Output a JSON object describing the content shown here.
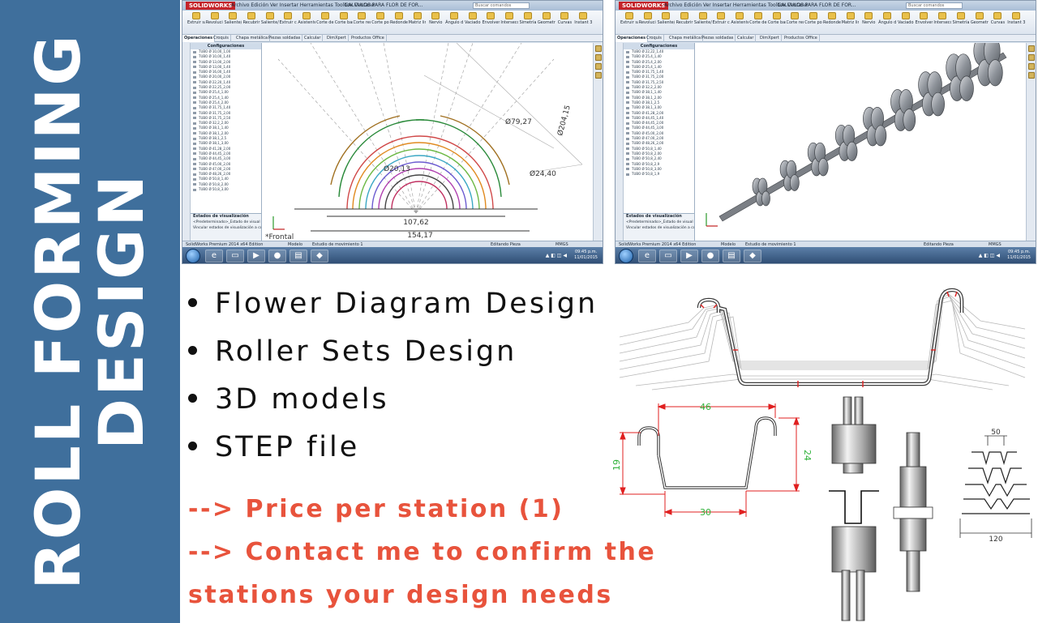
{
  "banner": {
    "line1": "ROLL FORMING",
    "line2": "DESIGN",
    "background_color": "#3f6f9c",
    "text_color": "#ffffff"
  },
  "features": [
    "Flower Diagram Design",
    "Roller Sets Design",
    "3D models",
    "STEP file"
  ],
  "cta": {
    "line1": "--> Price per station (1)",
    "line2": "--> Contact me to confirm the",
    "line3": "stations your design needs",
    "color": "#e8533c"
  },
  "cad": {
    "app_logo": "SOLIDWORKS",
    "menu": "Archivo  Edición  Ver  Insertar  Herramientas  Toolbox  Ventana",
    "window_title": "CALCULOS PARA FLOR DE FOR...",
    "search_placeholder": "Buscar comandos",
    "ribbon_buttons": [
      "Extruir saliente/base",
      "Revolución de saliente/base",
      "Saliente/Base barrido",
      "Recubrir",
      "Saliente/Base por límite",
      "Extruir corte",
      "Asistente para taladro",
      "Corte de revolución",
      "Corte barrido",
      "Corte recubierto",
      "Corte por límite",
      "Redondeo",
      "Matriz lineal",
      "Nervio",
      "Ángulo de salida",
      "Vaciado",
      "Envolver",
      "Intersección",
      "Simetría",
      "Geometría de referencia",
      "Curvas",
      "Instant 3D"
    ],
    "tabs": [
      "Operaciones",
      "Croquis",
      "Chapa metálica",
      "Piezas soldadas",
      "Calcular",
      "DimXpert",
      "Productos Office"
    ],
    "tree_header": "Configuraciones",
    "tree_rows_1": [
      "TUBO Ø 10,00_1,00",
      "TUBO Ø 10,00_1,40",
      "TUBO Ø 13,00_2,00",
      "TUBO Ø 13,00_1,40",
      "TUBO Ø 16,00_1,40",
      "TUBO Ø 20,00_2,00",
      "TUBO Ø 22,20_1,40",
      "TUBO Ø 22,25_2,00",
      "TUBO Ø 25,4_1,00",
      "TUBO Ø 25,4_1,40",
      "TUBO Ø 25,4_2,00",
      "TUBO Ø 31,75_1,40",
      "TUBO Ø 31,75_2,00",
      "TUBO Ø 31,75_2,50",
      "TUBO Ø 32,2_2,00",
      "TUBO Ø 38,1_1,40",
      "TUBO Ø 38,1_2,00",
      "TUBO Ø 38,1_2,5",
      "TUBO Ø 38,1_3,00",
      "TUBO Ø 41,28_2,00",
      "TUBO Ø 44,45_2,00",
      "TUBO Ø 44,45_3,00",
      "TUBO Ø 45,00_2,00",
      "TUBO Ø 47,00_2,00",
      "TUBO Ø 48,26_2,00",
      "TUBO Ø 50,8_1,40",
      "TUBO Ø 50,8_2,00",
      "TUBO Ø 50,8_3,00"
    ],
    "tree_rows_2": [
      "TUBO Ø 22,22_1,40",
      "TUBO Ø 25,4_1,40",
      "TUBO Ø 25,4_2,00",
      "TUBO Ø 25,4_1,40",
      "TUBO Ø 31,75_1,40",
      "TUBO Ø 31,75_2,00",
      "TUBO Ø 31,75_2,50",
      "TUBO Ø 32,2_2,00",
      "TUBO Ø 38,1_1,40",
      "TUBO Ø 38,1_2,00",
      "TUBO Ø 38,1_2,5",
      "TUBO Ø 38,1_3,00",
      "TUBO Ø 41,28_2,00",
      "TUBO Ø 44,45_1,40",
      "TUBO Ø 44,45_2,00",
      "TUBO Ø 44,45_3,00",
      "TUBO Ø 45,00_2,00",
      "TUBO Ø 47,00_2,00",
      "TUBO Ø 48,26_2,00",
      "TUBO Ø 50,8_1,40",
      "TUBO Ø 50,8_2,00",
      "TUBO Ø 50,8_2,40",
      "TUBO Ø 50,8_2,9",
      "TUBO Ø 50,8_3,00",
      "TUBO Ø 50,8_1,9"
    ],
    "footer_title": "Estados de visualización",
    "footer_row": "<Predeterminado>_Estado de visual",
    "footer_check": "Vincular estados de visualización a confi",
    "status_left": "SolidWorks Premium 2014 x64 Edition",
    "status_mid": "Editando Pieza",
    "status_units": "MMGS",
    "bottom_tabs": [
      "Modelo",
      "Estudio de movimiento 1"
    ],
    "axis_label": "*Frontal",
    "dims_flower": [
      "107,62",
      "154,17",
      "Ø79,27",
      "Ø24,40",
      "Ø20,13",
      "Ø204,15"
    ],
    "clock_time": "09:45 p.m.",
    "clock_date": "11/01/2015"
  },
  "drawings": {
    "profile_dims": [
      "46",
      "19",
      "24",
      "30"
    ],
    "roller_dims": [
      "50",
      "120"
    ],
    "profile_color": "#e02020",
    "dim_color": "#2fb23a"
  }
}
